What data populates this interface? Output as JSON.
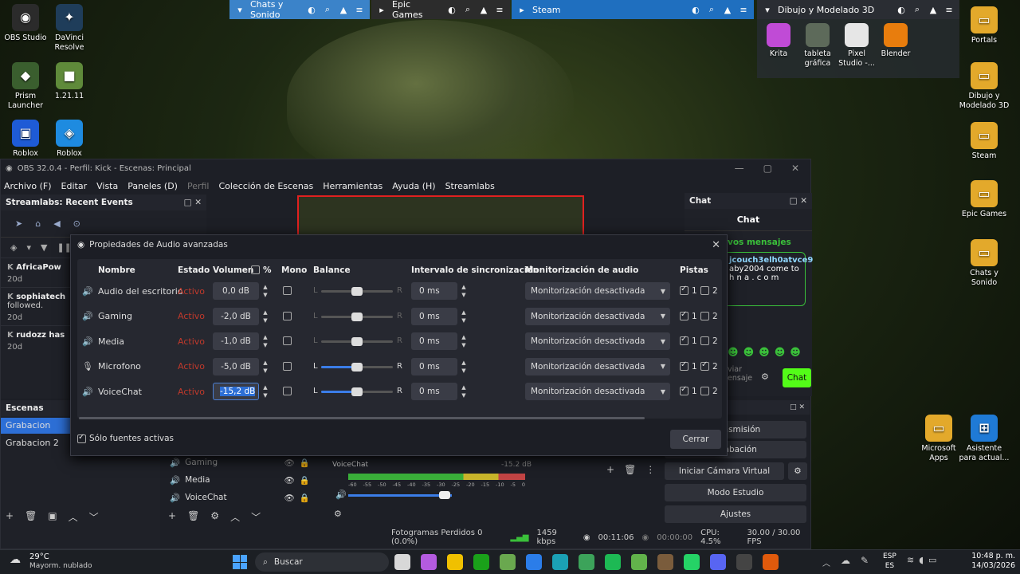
{
  "desktop_icons_left": [
    {
      "label": "OBS Studio",
      "color": "#2b2b2b",
      "glyph": "◉"
    },
    {
      "label": "DaVinci Resolve",
      "color": "#1f3d5a",
      "glyph": "✦"
    },
    {
      "label": "Prism Launcher",
      "color": "#3a5e2e",
      "glyph": "◆"
    },
    {
      "label": "1.21.11",
      "color": "#5f8a3a",
      "glyph": "■"
    },
    {
      "label": "Roblox Player",
      "color": "#1e5bd6",
      "glyph": "▣"
    },
    {
      "label": "Roblox Studio",
      "color": "#1e8be0",
      "glyph": "◈"
    }
  ],
  "desktop_icons_right": [
    {
      "label": "Portals",
      "color": "#e3a92b",
      "glyph": "▭"
    },
    {
      "label": "Dibujo y Modelado 3D",
      "color": "#e3a92b",
      "glyph": "▭"
    },
    {
      "label": "Steam",
      "color": "#e3a92b",
      "glyph": "▭"
    },
    {
      "label": "Epic Games",
      "color": "#e3a92b",
      "glyph": "▭"
    },
    {
      "label": "Chats y Sonido",
      "color": "#e3a92b",
      "glyph": "▭"
    },
    {
      "label": "Microsoft Apps",
      "color": "#e3a92b",
      "glyph": "▭"
    },
    {
      "label": "Asistente para actual...",
      "color": "#1f7ad6",
      "glyph": "⊞"
    }
  ],
  "fences": [
    {
      "title": "Chats y Sonido",
      "color": "#3b83c9"
    },
    {
      "title": "Epic Games",
      "color": "#2c2c2c"
    },
    {
      "title": "Steam",
      "color": "#1f6fbf"
    },
    {
      "title": "Dibujo y Modelado 3D",
      "color": "#2a2d33"
    }
  ],
  "fence_icons": [
    {
      "label": "Krita",
      "color": "#c04bd6"
    },
    {
      "label": "tableta gráfica",
      "color": "#5d6a5a"
    },
    {
      "label": "Pixel Studio -...",
      "color": "#e6e6e6"
    },
    {
      "label": "Blender",
      "color": "#e87d0d"
    }
  ],
  "obs": {
    "title": "OBS 32.0.4 - Perfil: Kick - Escenas: Principal",
    "menu": [
      {
        "label": "Archivo (F)",
        "disabled": false
      },
      {
        "label": "Editar",
        "disabled": false
      },
      {
        "label": "Vista",
        "disabled": false
      },
      {
        "label": "Paneles (D)",
        "disabled": false
      },
      {
        "label": "Perfil",
        "disabled": true
      },
      {
        "label": "Colección de Escenas",
        "disabled": false
      },
      {
        "label": "Herramientas",
        "disabled": false
      },
      {
        "label": "Ayuda (H)",
        "disabled": false
      },
      {
        "label": "Streamlabs",
        "disabled": false
      }
    ],
    "events_title": "Streamlabs: Recent Events",
    "events": [
      {
        "name": "AfricaPow",
        "time": "20d",
        "extra": ""
      },
      {
        "name": "sophiatech",
        "time": "20d",
        "extra": "followed."
      },
      {
        "name": "rudozz has",
        "time": "20d",
        "extra": ""
      }
    ],
    "chat_title": "Chat",
    "chat_header": "Chat",
    "chat_new": "vos mensajes",
    "chat_msg_user": "jcouch3elh0atvce9",
    "chat_msg_text": "aby2004 come to",
    "chat_msg_text2": "h n a . c o m",
    "chat_input": "viar\nensaje",
    "chat_button": "Chat",
    "scenes_title": "Escenas",
    "scenes": [
      "Grabacion",
      "Grabacion 2"
    ],
    "sources": [
      "Gaming",
      "Media",
      "VoiceChat"
    ],
    "mixer_label": "VoiceChat",
    "mixer_db": "-15.2 dB",
    "mixer_ticks": [
      "-60",
      "-55",
      "-50",
      "-45",
      "-40",
      "-35",
      "-30",
      "-25",
      "-20",
      "-15",
      "-10",
      "-5",
      "0"
    ],
    "controls": [
      "Iniciar Transmisión",
      "Iniciar Grabación",
      "Iniciar Cámara Virtual",
      "Modo Estudio",
      "Ajustes"
    ],
    "controls_visible": [
      "Transmisión",
      "Grabación",
      "Iniciar Cámara Virtual",
      "Modo Estudio",
      "Ajustes"
    ],
    "status": {
      "frames": "Fotogramas Perdidos 0 (0.0%)",
      "kbps": "1459 kbps",
      "rec_time": "00:11:06",
      "stream_time": "00:00:00",
      "cpu": "CPU: 4.5%",
      "fps": "30.00 / 30.00 FPS"
    }
  },
  "dialog": {
    "title": "Propiedades de Audio avanzadas",
    "headers": {
      "name": "Nombre",
      "state": "Estado",
      "volume": "Volumen",
      "pct": "%",
      "mono": "Mono",
      "balance": "Balance",
      "sync": "Intervalo de sincronización",
      "monitor": "Monitorización de audio",
      "tracks": "Pistas"
    },
    "rows": [
      {
        "name": "Audio del escritorio",
        "icon": "speaker-icon",
        "state": "Activo",
        "volume": "0,0 dB",
        "mono": false,
        "balance": 0.5,
        "balance_active": false,
        "sync": "0 ms",
        "monitor": "Monitorización desactivada",
        "t1": true,
        "t2": false
      },
      {
        "name": "Gaming",
        "icon": "speaker-icon",
        "state": "Activo",
        "volume": "-2,0 dB",
        "mono": false,
        "balance": 0.5,
        "balance_active": false,
        "sync": "0 ms",
        "monitor": "Monitorización desactivada",
        "t1": true,
        "t2": false
      },
      {
        "name": "Media",
        "icon": "speaker-icon",
        "state": "Activo",
        "volume": "-1,0 dB",
        "mono": false,
        "balance": 0.5,
        "balance_active": false,
        "sync": "0 ms",
        "monitor": "Monitorización desactivada",
        "t1": true,
        "t2": false
      },
      {
        "name": "Microfono",
        "icon": "microphone-icon",
        "state": "Activo",
        "volume": "-5,0 dB",
        "mono": false,
        "balance": 0.5,
        "balance_active": true,
        "sync": "0 ms",
        "monitor": "Monitorización desactivada",
        "t1": true,
        "t2": true
      },
      {
        "name": "VoiceChat",
        "icon": "speaker-icon",
        "state": "Activo",
        "volume": "-15,2 dB",
        "mono": false,
        "balance": 0.5,
        "balance_active": true,
        "sync": "0 ms",
        "monitor": "Monitorización desactivada",
        "t1": true,
        "t2": false
      }
    ],
    "track1": "1",
    "track2": "2",
    "bal_l": "L",
    "bal_r": "R",
    "only_active": "Sólo fuentes activas",
    "close": "Cerrar"
  },
  "taskbar": {
    "temp": "29°C",
    "weather": "Mayorm. nublado",
    "search": "Buscar",
    "lang1": "ESP",
    "lang2": "ES",
    "time": "10:48 p. m.",
    "date": "14/03/2026"
  }
}
